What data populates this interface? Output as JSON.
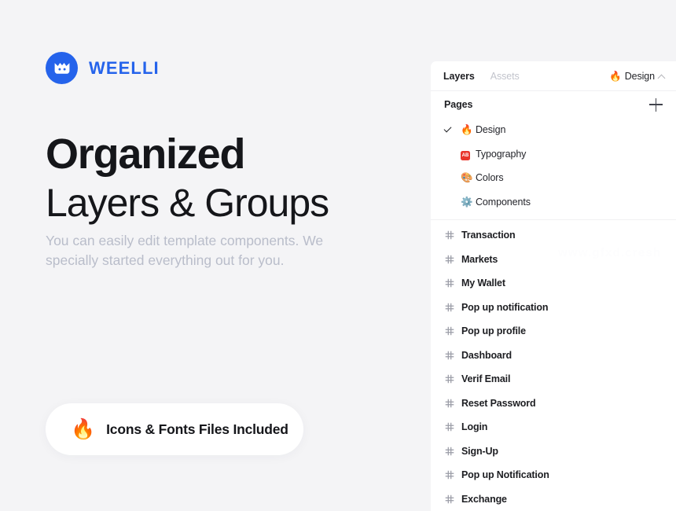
{
  "brand": {
    "name": "WEELLI",
    "logo_icon": "crown-mark-icon",
    "accent_color": "#2563eb"
  },
  "hero": {
    "headline_strong": "Organized",
    "headline_light": "Layers & Groups",
    "subcopy": "You can easily edit template components. We specially started everything out for you.",
    "pill": {
      "emoji": "🔥",
      "emoji_name": "fire-emoji",
      "label": "Icons & Fonts Files Included"
    },
    "text_color": "#15161a",
    "subcopy_color": "#b9bdca"
  },
  "panel": {
    "tabs": [
      {
        "label": "Layers",
        "active": true
      },
      {
        "label": "Assets",
        "active": false
      }
    ],
    "document": {
      "emoji": "🔥",
      "emoji_name": "fire-emoji",
      "label": "Design",
      "caret": "chevron-up-icon"
    },
    "pages_section": {
      "title": "Pages",
      "add_icon": "plus-icon",
      "items": [
        {
          "label": "Design",
          "emoji": "🔥",
          "emoji_name": "fire-emoji",
          "selected": true
        },
        {
          "label": "Typography",
          "emoji": "🆎",
          "emoji_name": "ab-badge-icon",
          "selected": false
        },
        {
          "label": "Colors",
          "emoji": "🎨",
          "emoji_name": "palette-emoji",
          "selected": false
        },
        {
          "label": "Components",
          "emoji": "⚙️",
          "emoji_name": "gear-emoji",
          "selected": false
        }
      ]
    },
    "frames": [
      {
        "label": "Transaction"
      },
      {
        "label": "Markets"
      },
      {
        "label": "My Wallet"
      },
      {
        "label": "Pop up notification"
      },
      {
        "label": "Pop up profile"
      },
      {
        "label": "Dashboard"
      },
      {
        "label": "Verif Email"
      },
      {
        "label": "Reset Password"
      },
      {
        "label": "Login"
      },
      {
        "label": "Sign-Up"
      },
      {
        "label": "Pop up Notification"
      },
      {
        "label": "Exchange"
      }
    ],
    "watermark": "www.gfxd.cresh",
    "background": "#ffffff"
  }
}
